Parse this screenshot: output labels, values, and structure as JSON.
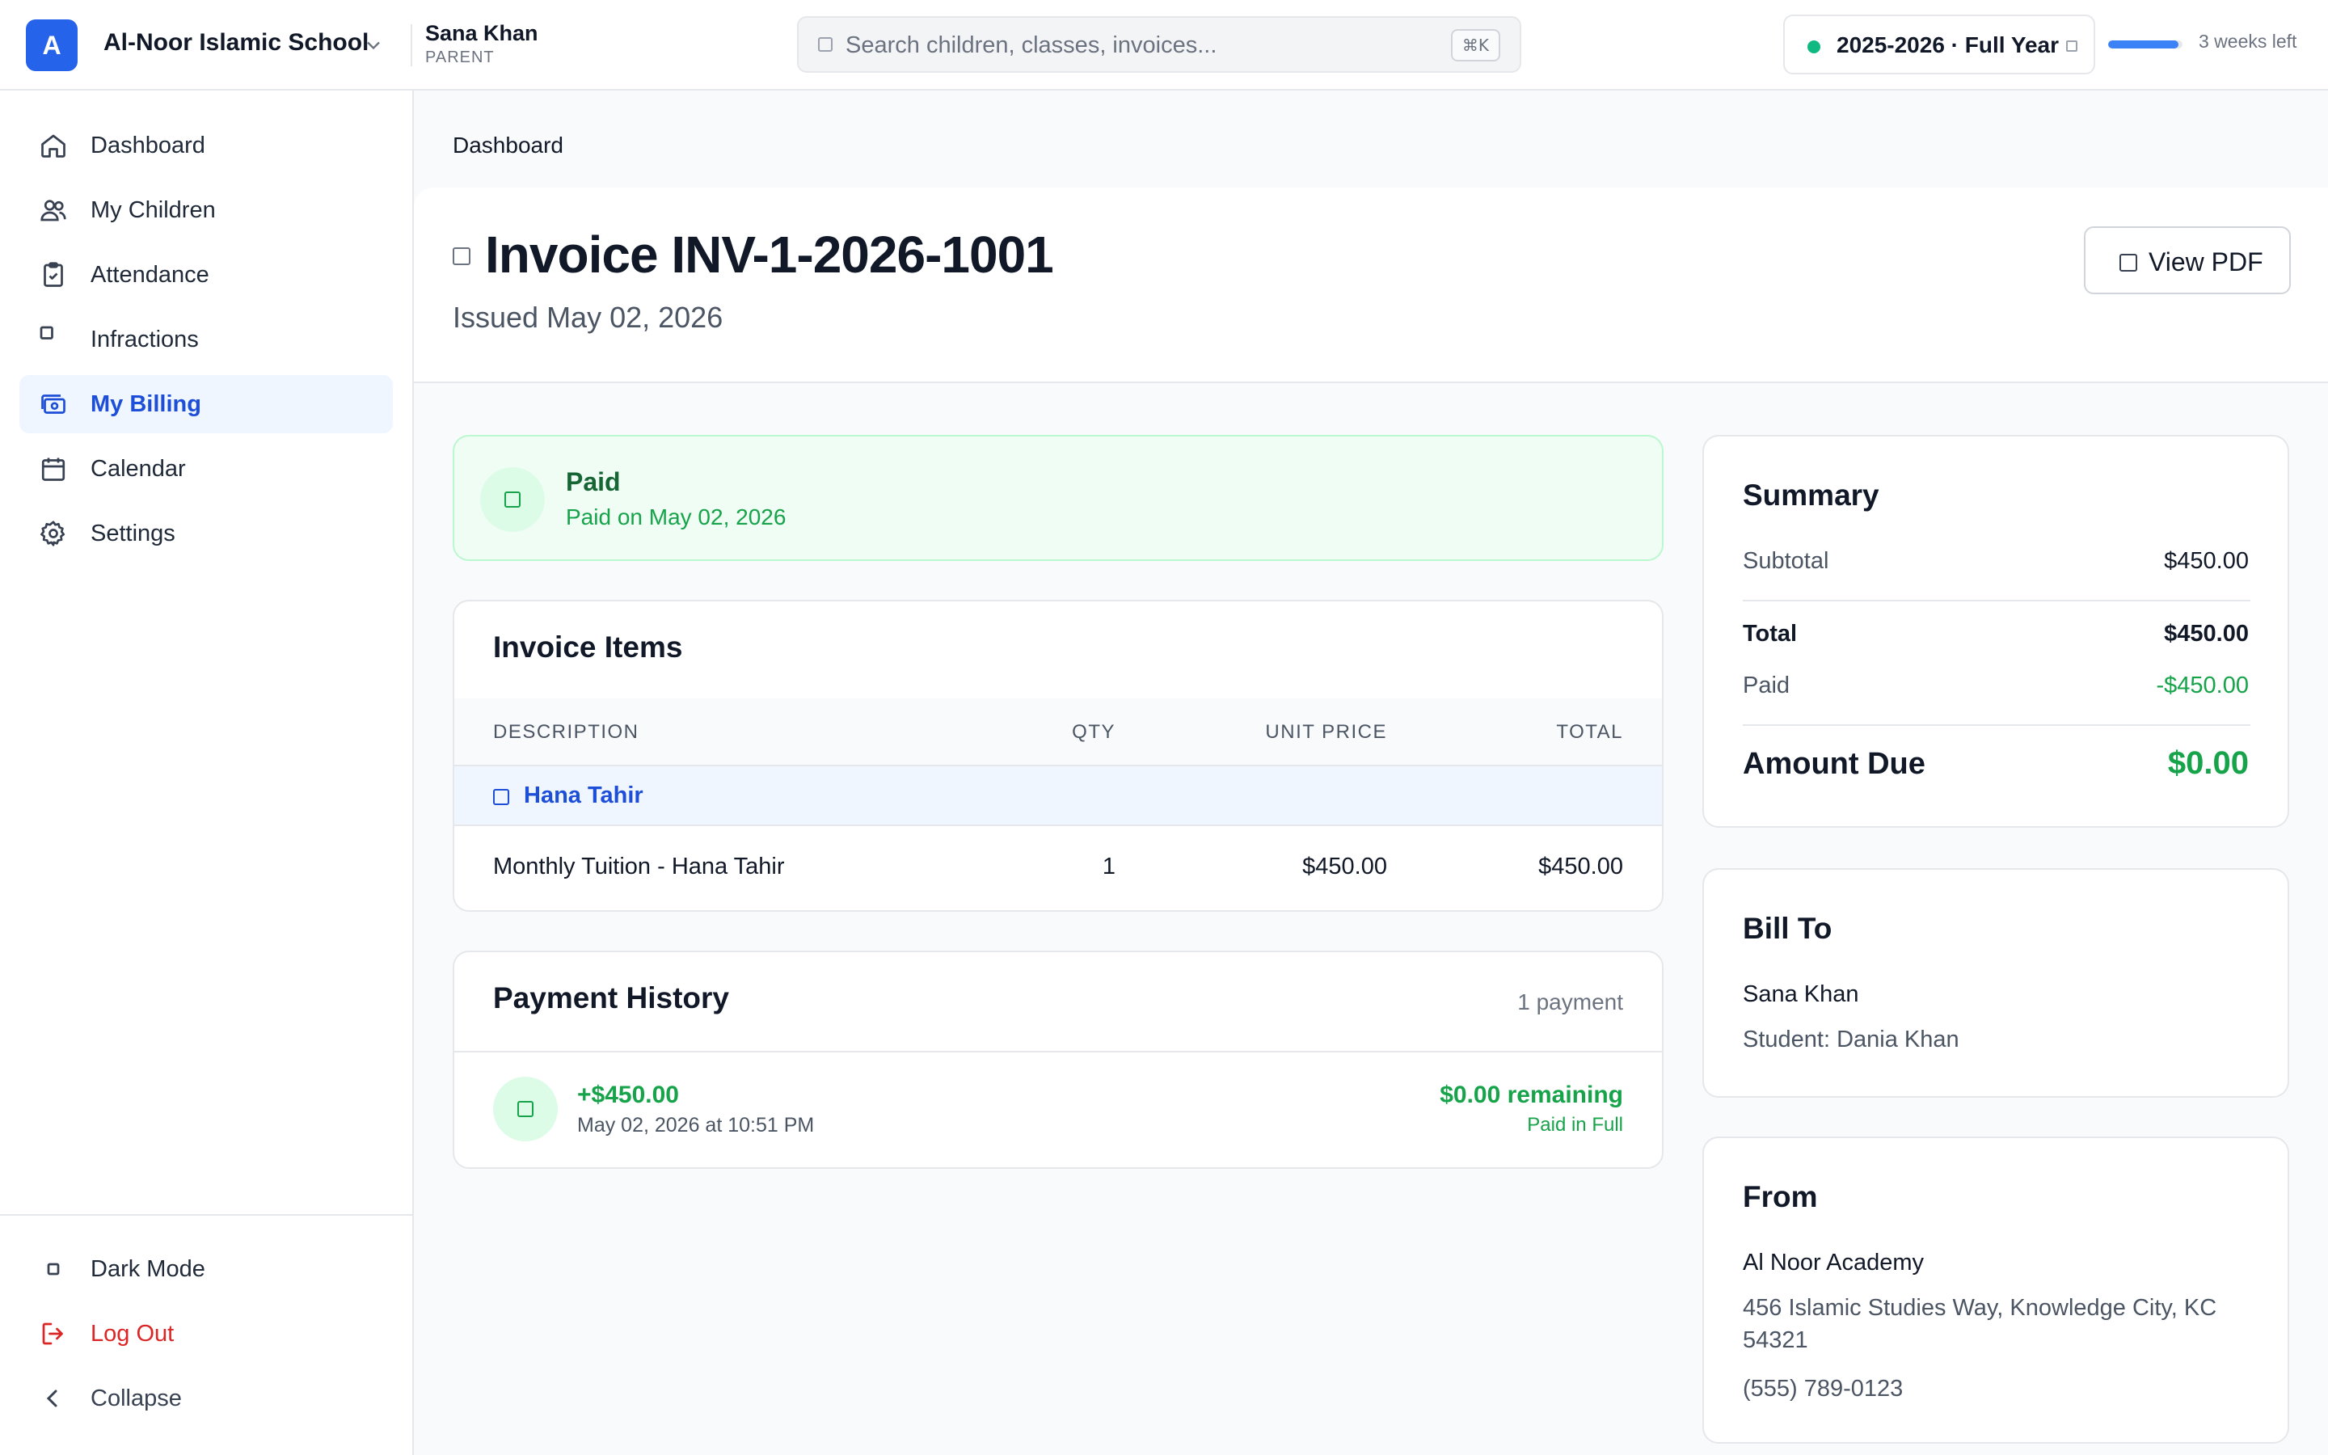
{
  "topbar": {
    "school_initial": "A",
    "school_name": "Al-Noor Islamic School",
    "user_name": "Sana Khan",
    "user_role": "PARENT",
    "search_placeholder": "Search children, classes, invoices...",
    "search_shortcut": "⌘K",
    "school_year": "2025-2026 · Full Year",
    "school_year_progress": 0.95,
    "weeks_left": "3 weeks left"
  },
  "sidebar": {
    "items": [
      {
        "label": "Dashboard",
        "icon": "home-icon"
      },
      {
        "label": "My Children",
        "icon": "users-icon"
      },
      {
        "label": "Attendance",
        "icon": "clipboard-check-icon"
      },
      {
        "label": "Infractions",
        "icon": "square-icon"
      },
      {
        "label": "My Billing",
        "icon": "billing-icon",
        "active": true
      },
      {
        "label": "Calendar",
        "icon": "calendar-icon"
      },
      {
        "label": "Settings",
        "icon": "gear-icon"
      }
    ],
    "footer": {
      "dark_mode": "Dark Mode",
      "logout": "Log Out",
      "collapse": "Collapse"
    }
  },
  "breadcrumb": "Dashboard",
  "invoice": {
    "title": "Invoice INV-1-2026-1001",
    "issued": "Issued May 02, 2026",
    "view_pdf": "View PDF",
    "status": {
      "title": "Paid",
      "subtitle": "Paid on May 02, 2026"
    },
    "items": {
      "title": "Invoice Items",
      "headers": {
        "description": "DESCRIPTION",
        "qty": "QTY",
        "unit_price": "UNIT PRICE",
        "total": "TOTAL"
      },
      "group": "Hana Tahir",
      "rows": [
        {
          "description": "Monthly Tuition - Hana Tahir",
          "qty": "1",
          "unit_price": "$450.00",
          "total": "$450.00"
        }
      ]
    },
    "payments": {
      "title": "Payment History",
      "count": "1 payment",
      "entries": [
        {
          "amount": "+$450.00",
          "date": "May 02, 2026 at 10:51 PM",
          "remaining": "$0.00 remaining",
          "status": "Paid in Full"
        }
      ]
    },
    "summary": {
      "title": "Summary",
      "subtotal_label": "Subtotal",
      "subtotal": "$450.00",
      "total_label": "Total",
      "total": "$450.00",
      "paid_label": "Paid",
      "paid": "-$450.00",
      "due_label": "Amount Due",
      "due": "$0.00"
    },
    "bill_to": {
      "title": "Bill To",
      "name": "Sana Khan",
      "student": "Student: Dania Khan"
    },
    "from": {
      "title": "From",
      "name": "Al Noor Academy",
      "address": "456 Islamic Studies Way, Knowledge City, KC 54321",
      "phone": "(555) 789-0123"
    }
  },
  "colors": {
    "accent": "#2563eb",
    "success": "#16a34a",
    "danger": "#dc2626"
  }
}
